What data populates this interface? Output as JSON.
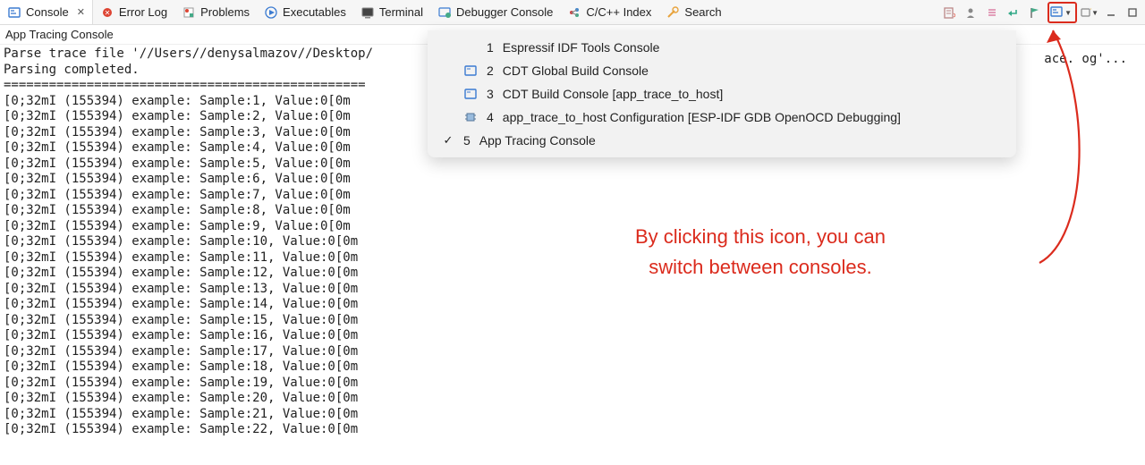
{
  "tabs": [
    {
      "label": "Console",
      "icon": "console-icon",
      "active": true,
      "closable": true
    },
    {
      "label": "Error Log",
      "icon": "error-icon"
    },
    {
      "label": "Problems",
      "icon": "problems-icon"
    },
    {
      "label": "Executables",
      "icon": "exec-icon"
    },
    {
      "label": "Terminal",
      "icon": "terminal-icon"
    },
    {
      "label": "Debugger Console",
      "icon": "debugger-icon"
    },
    {
      "label": "C/C++ Index",
      "icon": "index-icon"
    },
    {
      "label": "Search",
      "icon": "search-icon"
    }
  ],
  "subtitle": "App Tracing Console",
  "console": {
    "parse_line": "Parse trace file '//Users//denysalmazov//Desktop/",
    "parse_done": "Parsing completed.",
    "divider": "================================================",
    "trail": "ace. og'...",
    "lines": [
      "[0;32mI (155394) example: Sample:1, Value:0[0m",
      "[0;32mI (155394) example: Sample:2, Value:0[0m",
      "[0;32mI (155394) example: Sample:3, Value:0[0m",
      "[0;32mI (155394) example: Sample:4, Value:0[0m",
      "[0;32mI (155394) example: Sample:5, Value:0[0m",
      "[0;32mI (155394) example: Sample:6, Value:0[0m",
      "[0;32mI (155394) example: Sample:7, Value:0[0m",
      "[0;32mI (155394) example: Sample:8, Value:0[0m",
      "[0;32mI (155394) example: Sample:9, Value:0[0m",
      "[0;32mI (155394) example: Sample:10, Value:0[0m",
      "[0;32mI (155394) example: Sample:11, Value:0[0m",
      "[0;32mI (155394) example: Sample:12, Value:0[0m",
      "[0;32mI (155394) example: Sample:13, Value:0[0m",
      "[0;32mI (155394) example: Sample:14, Value:0[0m",
      "[0;32mI (155394) example: Sample:15, Value:0[0m",
      "[0;32mI (155394) example: Sample:16, Value:0[0m",
      "[0;32mI (155394) example: Sample:17, Value:0[0m",
      "[0;32mI (155394) example: Sample:18, Value:0[0m",
      "[0;32mI (155394) example: Sample:19, Value:0[0m",
      "[0;32mI (155394) example: Sample:20, Value:0[0m",
      "[0;32mI (155394) example: Sample:21, Value:0[0m",
      "[0;32mI (155394) example: Sample:22, Value:0[0m"
    ]
  },
  "dropdown": [
    {
      "num": "1",
      "label": "Espressif IDF Tools Console",
      "checked": false
    },
    {
      "num": "2",
      "label": "CDT Global Build Console",
      "checked": false,
      "icon": "console-icon"
    },
    {
      "num": "3",
      "label": "CDT Build Console [app_trace_to_host]",
      "checked": false,
      "icon": "console-icon"
    },
    {
      "num": "4",
      "label": "app_trace_to_host Configuration [ESP-IDF GDB OpenOCD Debugging]",
      "checked": false,
      "icon": "chip-icon"
    },
    {
      "num": "5",
      "label": "App Tracing Console",
      "checked": true
    }
  ],
  "annotation": {
    "line1": "By clicking this icon, you can",
    "line2": "switch between consoles."
  },
  "toolbar_icons": [
    "edit-icon",
    "person-icon",
    "list-icon",
    "return-icon",
    "flag-icon"
  ],
  "window_icons": [
    "minimize-icon",
    "maximize-icon",
    "restore-icon"
  ]
}
